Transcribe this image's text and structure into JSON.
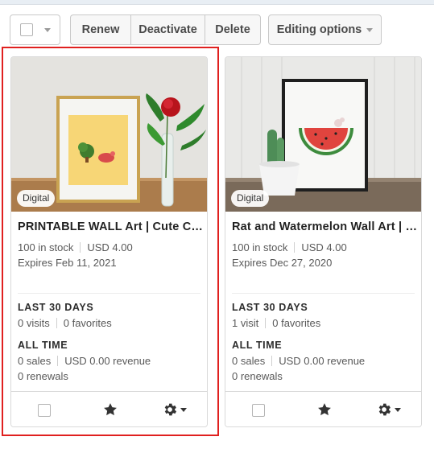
{
  "toolbar": {
    "renew_label": "Renew",
    "deactivate_label": "Deactivate",
    "delete_label": "Delete",
    "editing_options_label": "Editing options"
  },
  "listings": [
    {
      "badge": "Digital",
      "title": "PRINTABLE WALL Art | Cute Character Print",
      "stock": "100 in stock",
      "price": "USD 4.00",
      "expires": "Expires Feb 11, 2021",
      "last30_heading": "LAST 30 DAYS",
      "visits": "0 visits",
      "favorites": "0 favorites",
      "alltime_heading": "ALL TIME",
      "sales": "0 sales",
      "revenue": "USD 0.00 revenue",
      "renewals": "0 renewals"
    },
    {
      "badge": "Digital",
      "title": "Rat and Watermelon Wall Art | Boho Print",
      "stock": "100 in stock",
      "price": "USD 4.00",
      "expires": "Expires Dec 27, 2020",
      "last30_heading": "LAST 30 DAYS",
      "visits": "1 visit",
      "favorites": "0 favorites",
      "alltime_heading": "ALL TIME",
      "sales": "0 sales",
      "revenue": "USD 0.00 revenue",
      "renewals": "0 renewals"
    }
  ],
  "colors": {
    "highlight": "#e0201f",
    "star": "#333333"
  },
  "icons": [
    "checkbox-icon",
    "chevron-down-icon",
    "star-icon",
    "gear-icon"
  ]
}
